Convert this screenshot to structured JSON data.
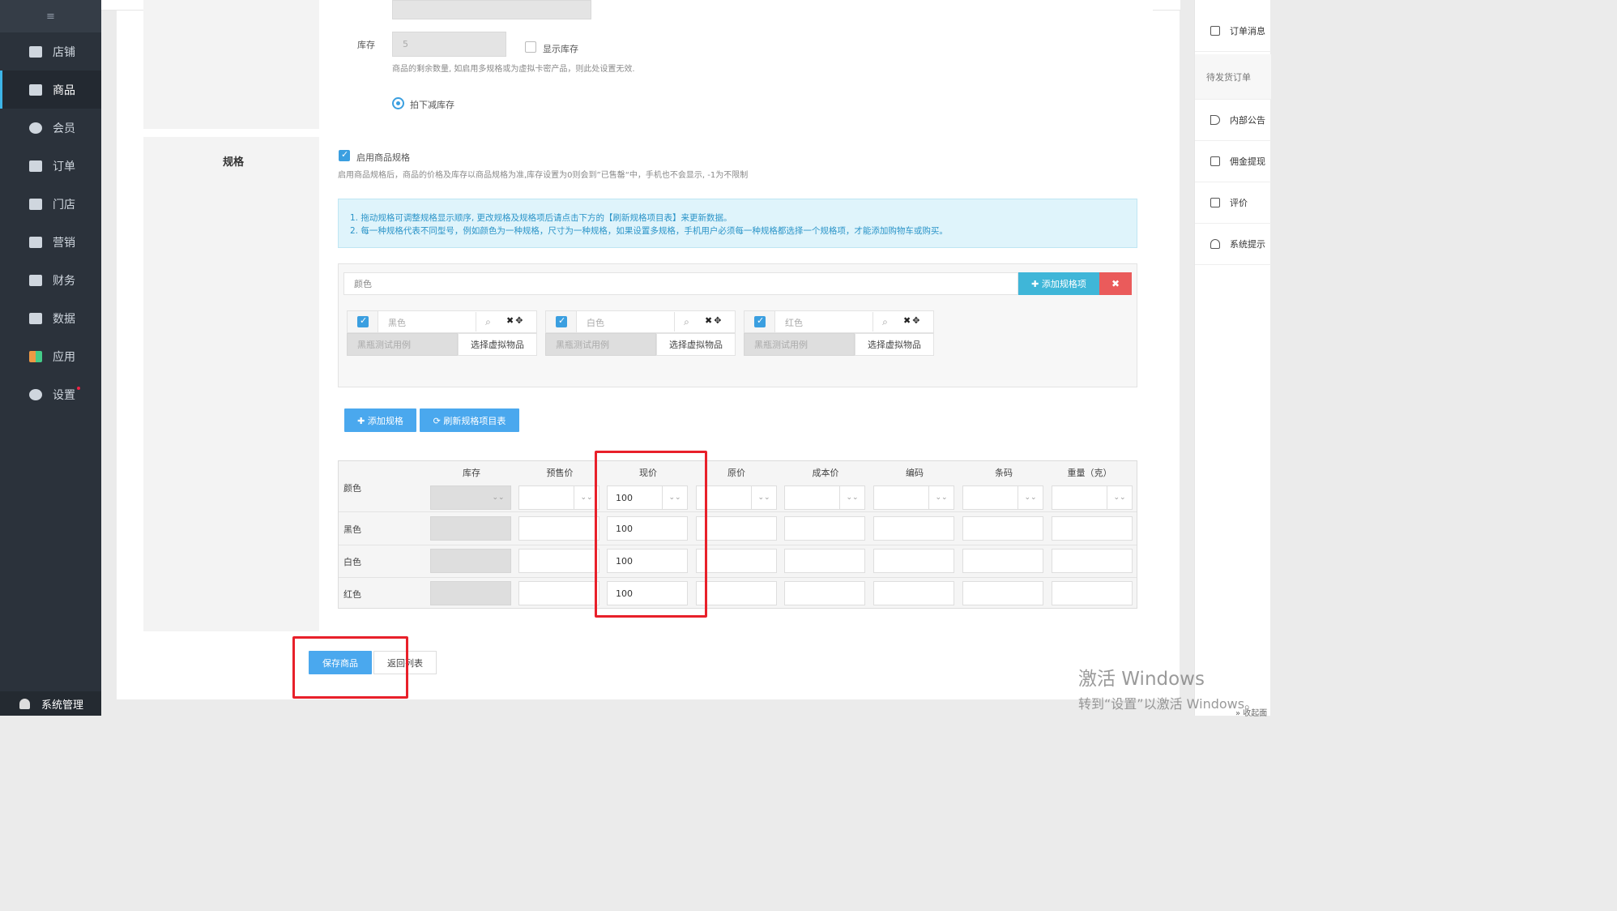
{
  "sidebar": {
    "toggle_icon": "≡",
    "items": [
      {
        "label": "店铺",
        "icon": "store-icon"
      },
      {
        "label": "商品",
        "icon": "goods-icon"
      },
      {
        "label": "会员",
        "icon": "user-icon"
      },
      {
        "label": "订单",
        "icon": "order-icon"
      },
      {
        "label": "门店",
        "icon": "shop-icon"
      },
      {
        "label": "营销",
        "icon": "gift-icon"
      },
      {
        "label": "财务",
        "icon": "money-bag-icon"
      },
      {
        "label": "数据",
        "icon": "chart-icon"
      },
      {
        "label": "应用",
        "icon": "apps-icon"
      },
      {
        "label": "设置",
        "icon": "gear-icon"
      }
    ],
    "active_index": 1,
    "bottom_label": "系统管理"
  },
  "stock_section": {
    "stock_label": "库存",
    "stock_value": "5",
    "show_stock_label": "显示库存",
    "stock_hint": "商品的剩余数量, 如启用多规格或为虚拟卡密产品，则此处设置无效.",
    "reduce_label": "拍下减库存"
  },
  "spec_section": {
    "title": "规格",
    "enable_label": "启用商品规格",
    "enable_hint": "启用商品规格后，商品的价格及库存以商品规格为准,库存设置为0则会到”已售罄“中，手机也不会显示, -1为不限制",
    "info_line1": "1. 拖动规格可调整规格显示顺序, 更改规格及规格项后请点击下方的【刷新规格项目表】来更新数据。",
    "info_line2": "2. 每一种规格代表不同型号，例如颜色为一种规格，尺寸为一种规格，如果设置多规格，手机用户必须每一种规格都选择一个规格项，才能添加购物车或购买。",
    "spec_name": "颜色",
    "add_item_label": "✚ 添加规格项",
    "delete_label": "✖",
    "items": [
      {
        "value": "黑色",
        "virtual": "黑瓶测试用例",
        "virtual_btn": "选择虚拟物品"
      },
      {
        "value": "白色",
        "virtual": "黑瓶测试用例",
        "virtual_btn": "选择虚拟物品"
      },
      {
        "value": "红色",
        "virtual": "黑瓶测试用例",
        "virtual_btn": "选择虚拟物品"
      }
    ],
    "add_spec_label": "✚ 添加规格",
    "refresh_label": "⟳ 刷新规格项目表"
  },
  "sku_table": {
    "headers": [
      "库存",
      "预售价",
      "现价",
      "原价",
      "成本价",
      "编码",
      "条码",
      "重量（克）"
    ],
    "rows": [
      {
        "label": "颜色",
        "price": "100"
      },
      {
        "label": "黑色",
        "price": "100"
      },
      {
        "label": "白色",
        "price": "100"
      },
      {
        "label": "红色",
        "price": "100"
      }
    ]
  },
  "actions": {
    "save_label": "保存商品",
    "back_label": "返回列表"
  },
  "right_panel": {
    "items": [
      {
        "label": "订单消息",
        "icon": "document-icon"
      },
      {
        "label": "待发货订单",
        "icon": ""
      },
      {
        "label": "内部公告",
        "icon": "speaker-icon"
      },
      {
        "label": "佣金提现",
        "icon": "wallet-icon"
      },
      {
        "label": "评价",
        "icon": "comment-icon"
      },
      {
        "label": "系统提示",
        "icon": "bell-icon"
      }
    ],
    "collapse_label": "» 收起面"
  },
  "watermark": {
    "line1": "激活 Windows",
    "line2": "转到“设置”以激活 Windows。"
  },
  "colors": {
    "sidebar_bg": "#2b323b",
    "accent_blue": "#4aa8ee",
    "teal": "#3fb6d8",
    "danger": "#ea5b5b",
    "highlight_red": "#e8202a"
  }
}
